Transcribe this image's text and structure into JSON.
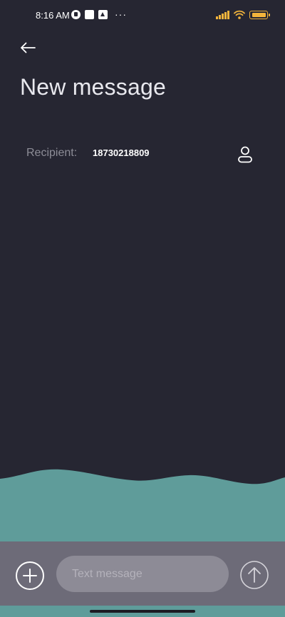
{
  "status_bar": {
    "time": "8:16 AM",
    "left_icons": [
      "app-notification-icon",
      "square-notification-icon",
      "upload-notification-icon",
      "more-dots-icon"
    ],
    "right_icons": [
      "signal-icon",
      "wifi-icon",
      "battery-icon"
    ],
    "dots": "···",
    "accent_color": "#f2b43c"
  },
  "header": {
    "back_icon": "arrow-left-icon",
    "title": "New message"
  },
  "recipient": {
    "label": "Recipient:",
    "value": "18730218809",
    "contact_icon": "person-icon"
  },
  "composer": {
    "add_icon": "plus-circle-icon",
    "placeholder": "Text message",
    "value": "",
    "send_icon": "arrow-up-circle-icon"
  },
  "colors": {
    "background": "#262632",
    "wave": "#5f9c9a",
    "composer_bar": "#6d6b78",
    "input_bg": "#8d8b96"
  }
}
